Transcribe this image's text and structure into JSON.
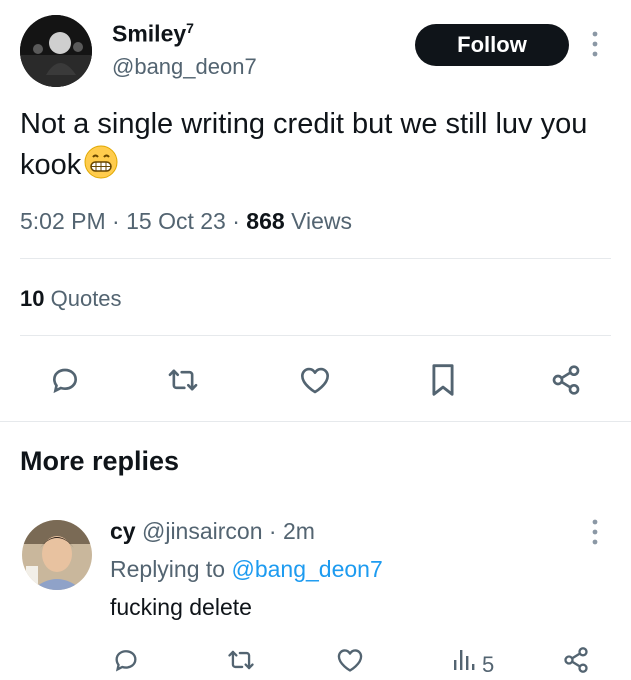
{
  "tweet": {
    "author_name": "Smiley",
    "author_badge": "7",
    "author_handle": "@bang_deon7",
    "follow_label": "Follow",
    "text": "Not a single writing credit but we still luv you kook",
    "emoji": "grinning-face-with-teeth",
    "time": "5:02 PM",
    "date": "15 Oct 23",
    "views_count": "868",
    "views_label": "Views",
    "quotes_count": "10",
    "quotes_label": "Quotes",
    "sep": "·"
  },
  "section": {
    "title": "More replies"
  },
  "reply": {
    "name": "cy",
    "handle": "@jinsaircon",
    "time": "2m",
    "replying_prefix": "Replying to",
    "replying_handle": "@bang_deon7",
    "text": "fucking delete",
    "views": "5"
  },
  "icons": [
    "reply-icon",
    "retweet-icon",
    "like-icon",
    "bookmark-icon",
    "share-icon",
    "views-icon",
    "more-icon"
  ],
  "colors": {
    "text": "#0f1419",
    "muted": "#536471",
    "link": "#1d9bf0",
    "divider": "#e6e9ec",
    "button": "#0f1419"
  }
}
